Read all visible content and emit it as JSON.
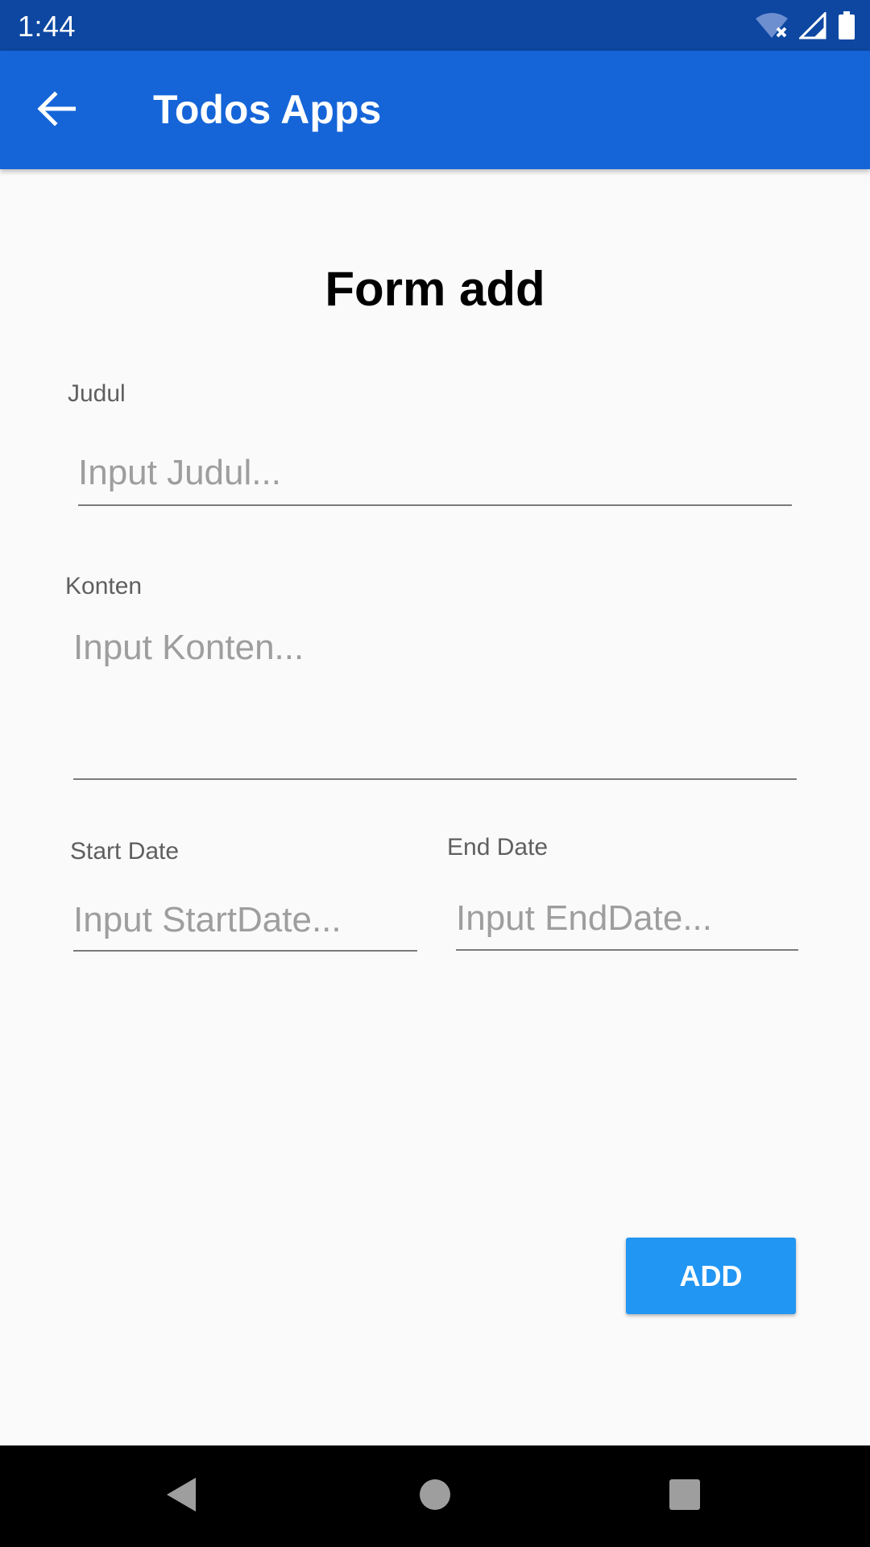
{
  "status_bar": {
    "time": "1:44",
    "icons": [
      "wifi-x-icon",
      "signal-icon",
      "battery-icon"
    ]
  },
  "app_bar": {
    "back_icon": "arrow-left-icon",
    "title": "Todos Apps",
    "color": "#1565d8"
  },
  "form": {
    "title": "Form add",
    "judul": {
      "label": "Judul",
      "placeholder": "Input Judul..."
    },
    "konten": {
      "label": "Konten",
      "placeholder": "Input Konten..."
    },
    "start_date": {
      "label": "Start Date",
      "placeholder": "Input StartDate..."
    },
    "end_date": {
      "label": "End Date",
      "placeholder": "Input EndDate..."
    },
    "add_label": "ADD",
    "add_color": "#2196f3"
  },
  "nav_bar": {
    "icons": [
      "back-triangle-icon",
      "home-circle-icon",
      "recents-square-icon"
    ]
  }
}
